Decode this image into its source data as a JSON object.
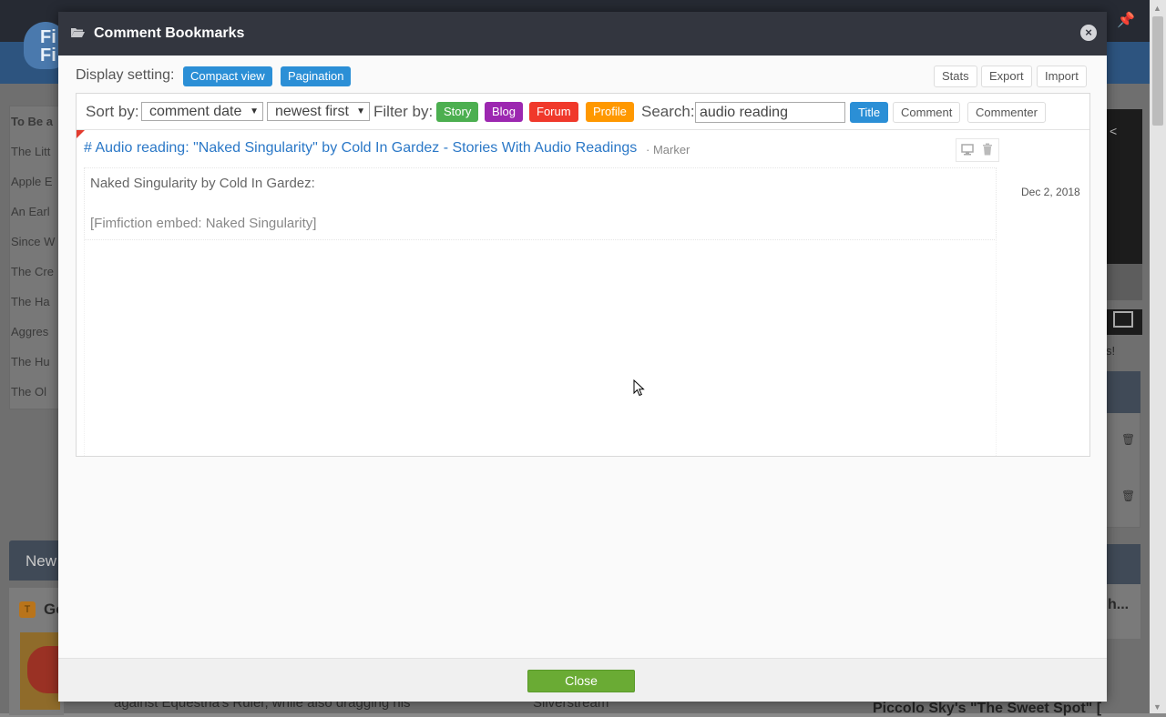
{
  "modal": {
    "title": "Comment Bookmarks",
    "close_label": "Close",
    "display_setting_label": "Display setting:",
    "view_buttons": [
      "Compact view",
      "Pagination"
    ],
    "tool_buttons": [
      "Stats",
      "Export",
      "Import"
    ]
  },
  "toolbar": {
    "sort_label": "Sort by:",
    "sort_field": "comment date",
    "sort_order": "newest first",
    "filter_label": "Filter by:",
    "filters": [
      {
        "label": "Story",
        "color": "#4caf50"
      },
      {
        "label": "Blog",
        "color": "#9c27b0"
      },
      {
        "label": "Forum",
        "color": "#f0392b"
      },
      {
        "label": "Profile",
        "color": "#ff9800"
      }
    ],
    "search_label": "Search:",
    "search_value": "audio reading",
    "search_modes": [
      "Title",
      "Comment",
      "Commenter"
    ],
    "active_search_mode": "Title"
  },
  "results": [
    {
      "title": "# Audio reading: \"Naked Singularity\" by Cold In Gardez - Stories With Audio Readings",
      "tag": "· Marker",
      "date": "Dec 2, 2018",
      "body_line1": "Naked Singularity by Cold In Gardez:",
      "body_line2": "[Fimfiction embed: Naked Singularity]"
    }
  ],
  "background": {
    "sidebar_heading": "To Be a",
    "sidebar_items": [
      "The Litt",
      "Apple E",
      "An Earl",
      "Since W",
      "The Cre",
      "The Ha",
      "Aggres",
      "The Hu",
      "The Ol"
    ],
    "new_bar_label": "New",
    "story_badge": "T",
    "story_title_start": "Go",
    "story_desc": "against Equestria's Ruler, while also dragging his",
    "bottom_name": "Silverstream",
    "bottom_right": "Piccolo Sky's \"The Sweet Spot\" [",
    "right_card_title": "h...",
    "right_excl": "s!",
    "logo_text": "Fi Fi"
  },
  "icons": {
    "folder": "folder-open-icon",
    "close": "close-circle-icon",
    "monitor": "monitor-icon",
    "trash": "trash-icon",
    "caret": "caret-down-icon",
    "pin": "pin-icon",
    "share": "share-icon",
    "cursor": "mouse-cursor-icon"
  }
}
